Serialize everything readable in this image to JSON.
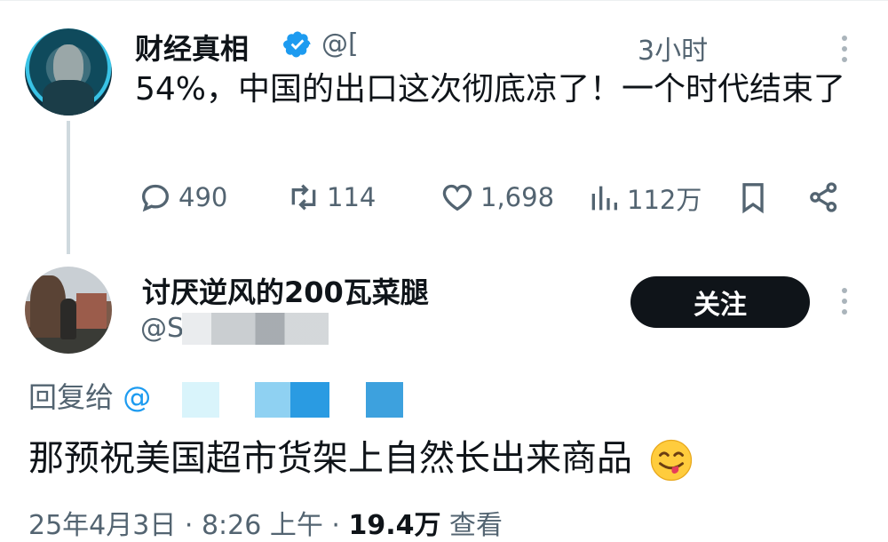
{
  "post": {
    "author_name": "财经真相",
    "handle_visible": "@[",
    "time_partial": "3小时",
    "text": "54%，中国的出口这次彻底凉了！一个时代结束了",
    "stats": {
      "replies": "490",
      "reposts": "114",
      "likes": "1,698",
      "views": "112万"
    }
  },
  "reply": {
    "author_name": "讨厌逆风的200瓦菜腿",
    "handle_visible": "@S",
    "follow_label": "关注",
    "reply_to_label": "回复给",
    "reply_to_at": "@",
    "text": "那预祝美国超市货架上自然长出来商品",
    "footer_date": "25年4月3日 · 8:26 上午 · ",
    "footer_views": "19.4万",
    "footer_views_label": " 查看"
  },
  "colors": {
    "accent": "#1d9bf0",
    "text": "#0f1419",
    "muted": "#536471",
    "button_bg": "#0f1419"
  },
  "icons": {
    "reply": "speech-bubble-icon",
    "repost": "repost-arrows-icon",
    "like": "heart-icon",
    "views": "bar-chart-icon",
    "bookmark": "bookmark-icon",
    "share": "share-icon",
    "verified": "verified-badge-icon",
    "emoji": "savoring-food-face-emoji"
  }
}
